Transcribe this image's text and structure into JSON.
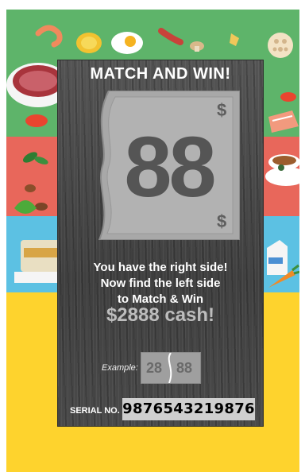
{
  "card": {
    "title": "MATCH AND WIN!",
    "number": "88",
    "currency_symbol": "$",
    "message_line1": "You have the right side!",
    "message_line2": "Now find the left side",
    "message_line3": "to Match & Win",
    "prize": "$2888 cash!",
    "example_label": "Example:",
    "example_left": "28",
    "example_right": "88",
    "serial_label": "SERIAL NO.",
    "serial_number": "9876543219876"
  },
  "colors": {
    "green": "#5eb46a",
    "red": "#e8675b",
    "blue": "#5cc1e3",
    "yellow": "#fed32d",
    "card": "#4a4a4a"
  },
  "icons": [
    "shrimp-icon",
    "corn-icon",
    "egg-icon",
    "sausage-icon",
    "mushroom-icon",
    "pasta-icon",
    "lotus-root-icon",
    "meat-plate-icon",
    "tomato-icon",
    "salmon-icon",
    "tea-leaves-icon",
    "teacup-icon",
    "lettuce-icon",
    "rice-bag-icon",
    "milk-carton-icon",
    "carrot-icon"
  ]
}
